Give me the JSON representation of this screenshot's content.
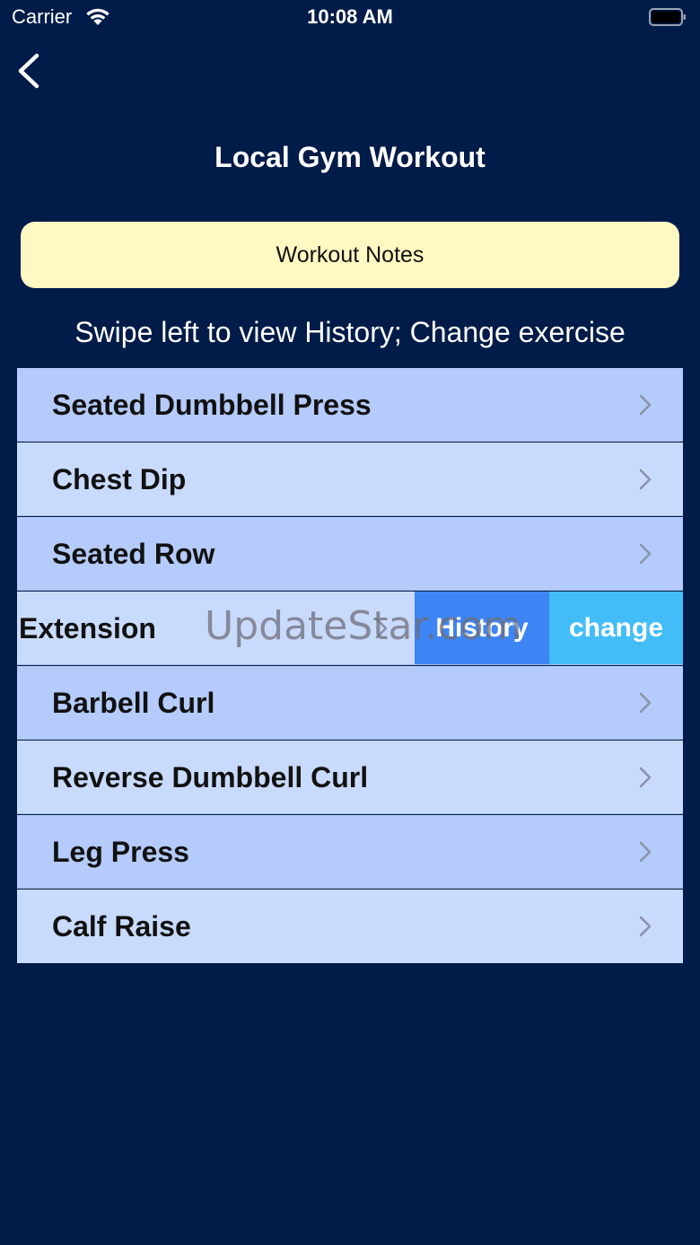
{
  "status_bar": {
    "carrier": "Carrier",
    "time": "10:08 AM",
    "wifi_icon": "wifi-icon",
    "battery_icon": "battery-full-icon"
  },
  "nav": {
    "back_icon": "chevron-left-icon"
  },
  "page": {
    "title": "Local Gym Workout",
    "notes_button": "Workout Notes",
    "hint": "Swipe left to view History; Change exercise"
  },
  "exercises": [
    {
      "name": "Seated Dumbbell Press"
    },
    {
      "name": "Chest Dip"
    },
    {
      "name": "Seated Row"
    },
    {
      "name": "Extension"
    },
    {
      "name": "Barbell Curl"
    },
    {
      "name": "Reverse Dumbbell Curl"
    },
    {
      "name": "Leg Press"
    },
    {
      "name": "Calf Raise"
    }
  ],
  "swipe_actions": {
    "history": "History",
    "change": "change"
  },
  "watermark": "UpdateStar.com",
  "colors": {
    "background": "#011c48",
    "notes_button": "#fff8c2",
    "row_a": "#b4cbfb",
    "row_b": "#c9dbfd",
    "history_action": "#3d84f5",
    "change_action": "#42bdf8"
  }
}
